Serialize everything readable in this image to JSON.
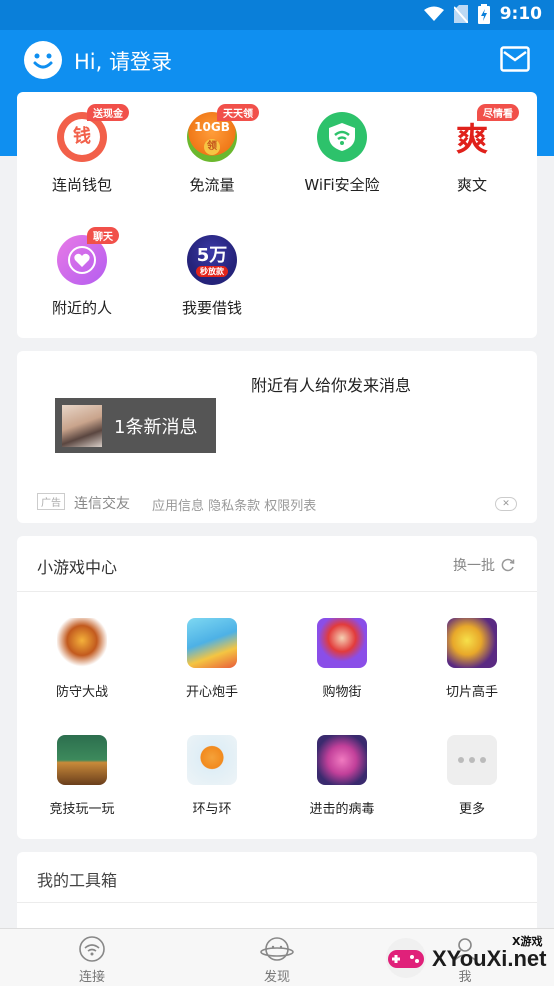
{
  "status": {
    "time": "9:10"
  },
  "header": {
    "greeting": "Hi, 请登录"
  },
  "services": [
    {
      "label": "连尚钱包",
      "badge": "送现金",
      "icon": "wallet-icon",
      "icon_text": "钱"
    },
    {
      "label": "免流量",
      "badge": "天天领",
      "icon": "free-data-icon",
      "icon_text": "10GB"
    },
    {
      "label": "WiFi安全险",
      "badge": "",
      "icon": "wifi-shield-icon",
      "icon_text": ""
    },
    {
      "label": "爽文",
      "badge": "尽情看",
      "icon": "novel-icon",
      "icon_text": "爽"
    },
    {
      "label": "附近的人",
      "badge": "聊天",
      "icon": "heart-icon",
      "icon_text": ""
    },
    {
      "label": "我要借钱",
      "badge": "",
      "icon": "loan-icon",
      "icon_text": "5万"
    }
  ],
  "loan_sub": "秒放款",
  "data_sub": "领",
  "message": {
    "title": "附近有人给你发来消息",
    "new_label": "1条新消息",
    "ad_tag": "广告",
    "ad_name": "连信交友",
    "ad_links": "应用信息 隐私条款 权限列表"
  },
  "games": {
    "title": "小游戏中心",
    "refresh": "换一批",
    "items": [
      {
        "label": "防守大战",
        "icon": "defense-game-icon"
      },
      {
        "label": "开心炮手",
        "icon": "cannon-game-icon"
      },
      {
        "label": "购物街",
        "icon": "shopping-game-icon"
      },
      {
        "label": "切片高手",
        "icon": "slice-game-icon"
      },
      {
        "label": "竞技玩一玩",
        "icon": "arena-game-icon"
      },
      {
        "label": "环与环",
        "icon": "ring-game-icon"
      },
      {
        "label": "进击的病毒",
        "icon": "virus-game-icon"
      },
      {
        "label": "更多",
        "icon": "more-icon"
      }
    ]
  },
  "toolbox": {
    "title": "我的工具箱"
  },
  "nav": [
    {
      "label": "连接",
      "icon": "wifi-icon"
    },
    {
      "label": "发现",
      "icon": "planet-icon"
    },
    {
      "label": "我",
      "icon": "user-icon"
    }
  ],
  "watermark": {
    "brand": "XYouXi.net",
    "tag": "X游戏"
  },
  "colors": {
    "primary": "#0f8ff0",
    "badge": "#f1504a"
  }
}
